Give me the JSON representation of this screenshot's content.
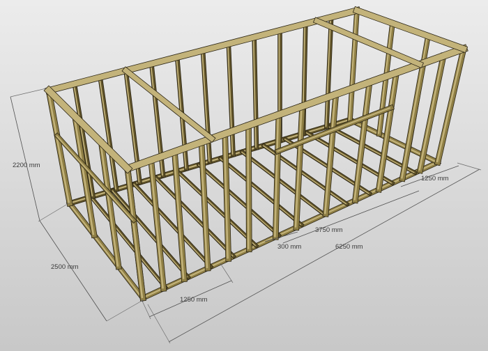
{
  "diagram": {
    "background_top": "#e9e9e9",
    "background_bottom": "#c9c9c9",
    "timber_top": "#c3b37a",
    "timber_side": "#8f7f45",
    "timber_dark": "#5f5228",
    "timber_outline": "#2b2515",
    "dimensions": {
      "height": "2200 mm",
      "width": "2500 mm",
      "front_section": "1250 mm",
      "door_gap": "300 mm",
      "middle_section": "3750 mm",
      "total_length": "6250 mm",
      "rear_section": "1250 mm"
    }
  }
}
